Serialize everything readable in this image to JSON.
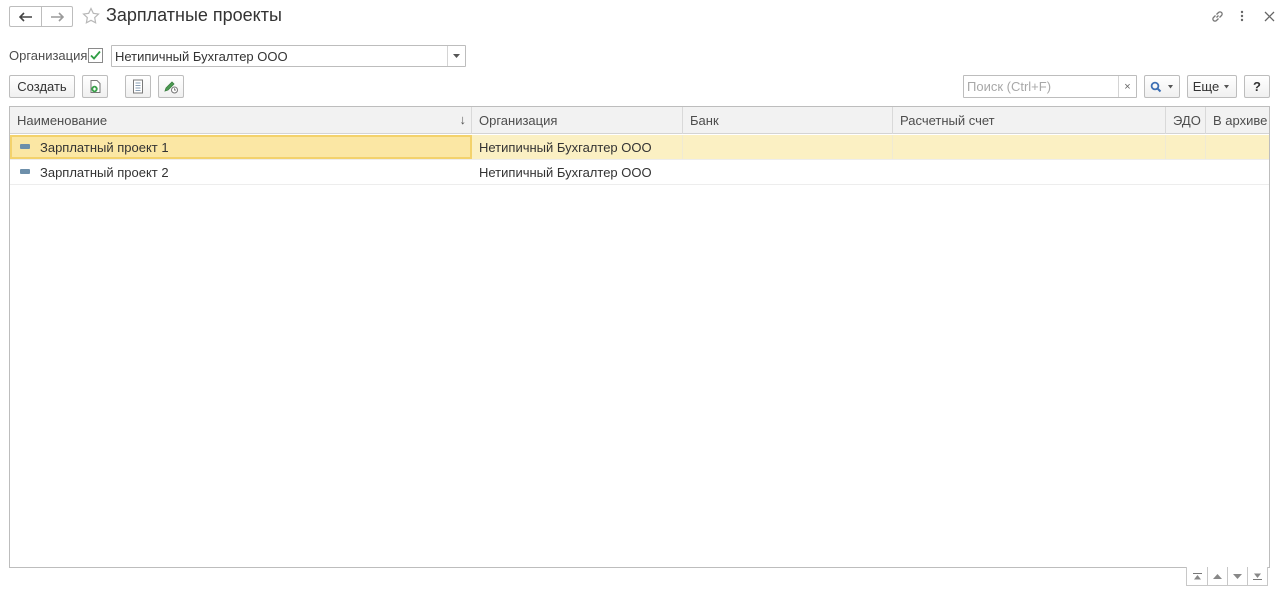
{
  "window": {
    "title": "Зарплатные проекты",
    "icons": [
      "link-icon",
      "more-icon",
      "close-icon"
    ]
  },
  "filter": {
    "organization_label": "Организация:",
    "organization_checked": true,
    "organization_value": "Нетипичный Бухгалтер ООО"
  },
  "toolbar": {
    "create_label": "Создать",
    "more_label": "Еще",
    "help_label": "?",
    "search_placeholder": "Поиск (Ctrl+F)",
    "search_clear": "×"
  },
  "table": {
    "columns": [
      "Наименование",
      "Организация",
      "Банк",
      "Расчетный счет",
      "ЭДО",
      "В архиве"
    ],
    "sort_indicator": "↓",
    "rows": [
      {
        "name": "Зарплатный проект 1",
        "organization": "Нетипичный Бухгалтер ООО",
        "bank": "",
        "account": "",
        "edo": "",
        "archived": "",
        "selected": true
      },
      {
        "name": "Зарплатный проект 2",
        "organization": "Нетипичный Бухгалтер ООО",
        "bank": "",
        "account": "",
        "edo": "",
        "archived": "",
        "selected": false
      }
    ]
  },
  "colors": {
    "selection": "#fbf0c3",
    "check": "#2f9e44"
  }
}
